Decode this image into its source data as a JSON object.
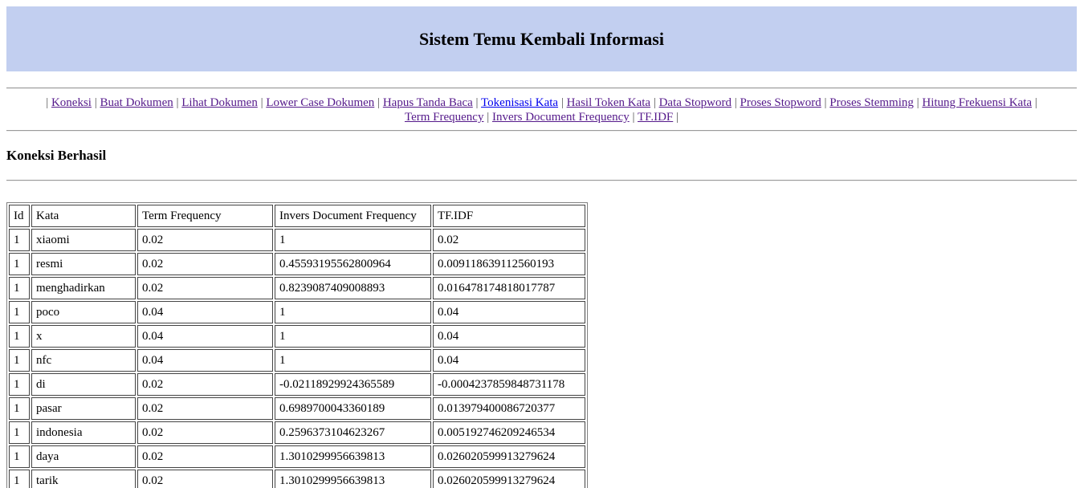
{
  "header": {
    "title": "Sistem Temu Kembali Informasi"
  },
  "nav": {
    "links": [
      {
        "label": "Koneksi"
      },
      {
        "label": "Buat Dokumen"
      },
      {
        "label": "Lihat Dokumen"
      },
      {
        "label": "Lower Case Dokumen"
      },
      {
        "label": "Hapus Tanda Baca"
      },
      {
        "label": "Tokenisasi Kata"
      },
      {
        "label": "Hasil Token Kata"
      },
      {
        "label": "Data Stopword"
      },
      {
        "label": "Proses Stopword"
      },
      {
        "label": "Proses Stemming"
      },
      {
        "label": "Hitung Frekuensi Kata"
      },
      {
        "label": "Term Frequency"
      },
      {
        "label": "Invers Document Frequency"
      },
      {
        "label": "TF.IDF"
      }
    ],
    "separator": "|"
  },
  "status": {
    "message": "Koneksi Berhasil"
  },
  "table": {
    "headers": [
      "Id",
      "Kata",
      "Term Frequency",
      "Invers Document Frequency",
      "TF.IDF"
    ],
    "rows": [
      [
        "1",
        "xiaomi",
        "0.02",
        "1",
        "0.02"
      ],
      [
        "1",
        "resmi",
        "0.02",
        "0.45593195562800964",
        "0.009118639112560193"
      ],
      [
        "1",
        "menghadirkan",
        "0.02",
        "0.8239087409008893",
        "0.016478174818017787"
      ],
      [
        "1",
        "poco",
        "0.04",
        "1",
        "0.04"
      ],
      [
        "1",
        "x",
        "0.04",
        "1",
        "0.04"
      ],
      [
        "1",
        "nfc",
        "0.04",
        "1",
        "0.04"
      ],
      [
        "1",
        "di",
        "0.02",
        "-0.02118929924365589",
        "-0.0004237859848731178"
      ],
      [
        "1",
        "pasar",
        "0.02",
        "0.6989700043360189",
        "0.013979400086720377"
      ],
      [
        "1",
        "indonesia",
        "0.02",
        "0.2596373104623267",
        "0.005192746209246534"
      ],
      [
        "1",
        "daya",
        "0.02",
        "1.3010299956639813",
        "0.026020599913279624"
      ],
      [
        "1",
        "tarik",
        "0.02",
        "1.3010299956639813",
        "0.026020599913279624"
      ]
    ]
  },
  "colors": {
    "header_background": "#c2cff0",
    "link_visited": "#551a8b",
    "link_unvisited": "#0000ee"
  }
}
